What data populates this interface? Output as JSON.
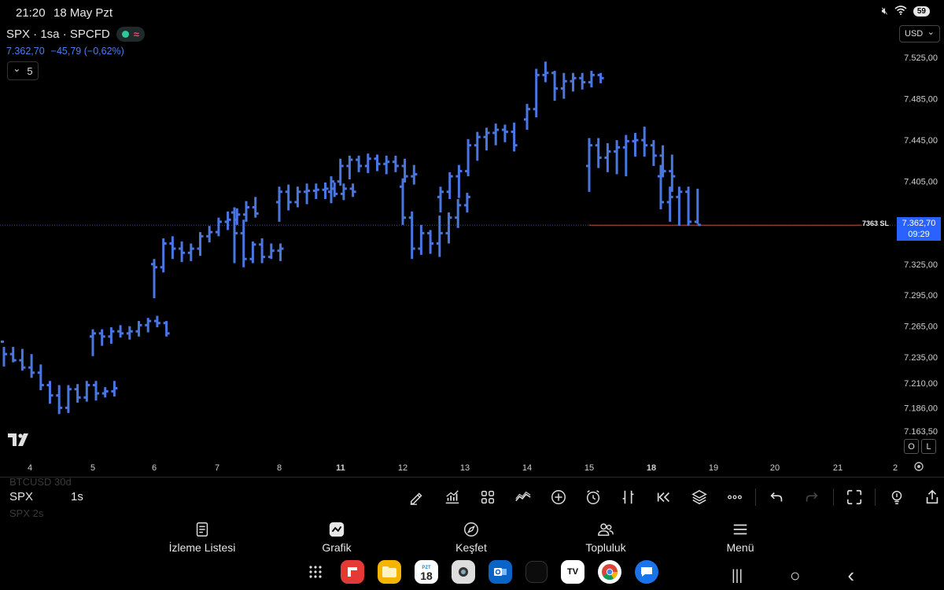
{
  "status_bar": {
    "time": "21:20",
    "date": "18 May Pzt",
    "battery": "59"
  },
  "header": {
    "symbol": "SPX · 1sa · SPCFD",
    "wave_glyph": "≈",
    "last_price": "7.362,70",
    "change": "−45,79 (−0,62%)",
    "interval_value": "5",
    "interval_chevron": "⌄",
    "currency": "USD",
    "currency_chevron": "⌄"
  },
  "chart_data": {
    "type": "ohlc",
    "bar_interval": "1sa",
    "x_labels": [
      "4",
      "5",
      "6",
      "7",
      "8",
      "11",
      "12",
      "13",
      "14",
      "15",
      "18",
      "19",
      "20",
      "21",
      "2"
    ],
    "y_labels": [
      "7.525,00",
      "7.485,00",
      "7.445,00",
      "7.405,00",
      "7.362,70",
      "7.325,00",
      "7.295,00",
      "7.265,00",
      "7.235,00",
      "7.210,00",
      "7.186,00",
      "7.163,50"
    ],
    "current_price": "7.362,70",
    "current_time_left": "09:29",
    "stop_level_label": "7363 SL",
    "series": [
      {
        "date": "4",
        "bars": [
          [
            7250,
            7245,
            7226,
            7238
          ],
          [
            7238,
            7245,
            7230,
            7232
          ],
          [
            7232,
            7243,
            7222,
            7225
          ],
          [
            7225,
            7238,
            7215,
            7220
          ],
          [
            7220,
            7228,
            7203,
            7208
          ],
          [
            7208,
            7212,
            7190,
            7198
          ],
          [
            7198,
            7208,
            7180,
            7186
          ],
          [
            7186,
            7208,
            7181,
            7204
          ],
          [
            7204,
            7209,
            7191,
            7196
          ],
          [
            7196,
            7212,
            7192,
            7208
          ],
          [
            7208,
            7212,
            7193,
            7200
          ],
          [
            7200,
            7206,
            7196,
            7202
          ],
          [
            7202,
            7212,
            7197,
            7205
          ]
        ]
      },
      {
        "date": "5",
        "bars": [
          [
            7255,
            7262,
            7236,
            7258
          ],
          [
            7258,
            7262,
            7246,
            7255
          ],
          [
            7255,
            7264,
            7248,
            7260
          ],
          [
            7260,
            7266,
            7254,
            7258
          ],
          [
            7258,
            7265,
            7252,
            7260
          ],
          [
            7260,
            7270,
            7255,
            7266
          ],
          [
            7266,
            7273,
            7259,
            7270
          ],
          [
            7270,
            7275,
            7264,
            7268
          ],
          [
            7268,
            7270,
            7255,
            7258
          ]
        ]
      },
      {
        "date": "6",
        "bars": [
          [
            7325,
            7330,
            7292,
            7322
          ],
          [
            7322,
            7350,
            7317,
            7345
          ],
          [
            7345,
            7352,
            7330,
            7340
          ],
          [
            7340,
            7347,
            7327,
            7336
          ],
          [
            7336,
            7345,
            7328,
            7340
          ],
          [
            7340,
            7356,
            7333,
            7352
          ],
          [
            7352,
            7362,
            7346,
            7356
          ],
          [
            7356,
            7370,
            7352,
            7366
          ],
          [
            7366,
            7376,
            7358,
            7368
          ],
          [
            7368,
            7379,
            7363,
            7373
          ],
          [
            7373,
            7386,
            7366,
            7380
          ],
          [
            7380,
            7390,
            7370,
            7374
          ]
        ]
      },
      {
        "date": "7",
        "bars": [
          [
            7375,
            7380,
            7326,
            7355
          ],
          [
            7355,
            7368,
            7322,
            7330
          ],
          [
            7330,
            7347,
            7326,
            7344
          ],
          [
            7344,
            7350,
            7326,
            7332
          ],
          [
            7332,
            7345,
            7330,
            7338
          ],
          [
            7338,
            7345,
            7328,
            7340
          ]
        ]
      },
      {
        "date": "8",
        "bars": [
          [
            7385,
            7400,
            7366,
            7395
          ],
          [
            7395,
            7402,
            7377,
            7385
          ],
          [
            7385,
            7400,
            7380,
            7395
          ],
          [
            7395,
            7403,
            7383,
            7396
          ],
          [
            7396,
            7403,
            7388,
            7397
          ],
          [
            7397,
            7404,
            7388,
            7398
          ],
          [
            7398,
            7404,
            7390,
            7393
          ],
          [
            7393,
            7403,
            7387,
            7398
          ],
          [
            7398,
            7403,
            7390,
            7395
          ]
        ]
      },
      {
        "date": "11",
        "bars": [
          [
            7395,
            7410,
            7384,
            7405
          ],
          [
            7405,
            7427,
            7401,
            7420
          ],
          [
            7420,
            7430,
            7407,
            7426
          ],
          [
            7426,
            7430,
            7414,
            7420
          ],
          [
            7420,
            7432,
            7413,
            7427
          ],
          [
            7427,
            7431,
            7415,
            7422
          ],
          [
            7422,
            7430,
            7412,
            7424
          ],
          [
            7424,
            7430,
            7414,
            7420
          ],
          [
            7420,
            7427,
            7404,
            7410
          ],
          [
            7410,
            7421,
            7402,
            7412
          ]
        ]
      },
      {
        "date": "12",
        "bars": [
          [
            7400,
            7408,
            7363,
            7370
          ],
          [
            7370,
            7376,
            7330,
            7340
          ],
          [
            7340,
            7363,
            7334,
            7355
          ],
          [
            7355,
            7358,
            7335,
            7345
          ],
          [
            7345,
            7372,
            7332,
            7355
          ],
          [
            7355,
            7375,
            7345,
            7370
          ],
          [
            7370,
            7388,
            7360,
            7382
          ],
          [
            7382,
            7394,
            7375,
            7390
          ]
        ]
      },
      {
        "date": "13",
        "bars": [
          [
            7390,
            7400,
            7375,
            7395
          ],
          [
            7395,
            7414,
            7388,
            7410
          ],
          [
            7410,
            7421,
            7389,
            7415
          ],
          [
            7415,
            7446,
            7410,
            7440
          ],
          [
            7440,
            7453,
            7425,
            7448
          ],
          [
            7448,
            7457,
            7435,
            7452
          ],
          [
            7452,
            7461,
            7440,
            7455
          ],
          [
            7455,
            7460,
            7443,
            7453
          ],
          [
            7453,
            7462,
            7434,
            7440
          ]
        ]
      },
      {
        "date": "14",
        "bars": [
          [
            7465,
            7480,
            7455,
            7475
          ],
          [
            7475,
            7514,
            7467,
            7508
          ],
          [
            7508,
            7521,
            7501,
            7510
          ],
          [
            7510,
            7512,
            7483,
            7495
          ],
          [
            7495,
            7510,
            7485,
            7502
          ],
          [
            7502,
            7510,
            7492,
            7505
          ],
          [
            7505,
            7510,
            7494,
            7501
          ],
          [
            7501,
            7512,
            7496,
            7508
          ],
          [
            7508,
            7510,
            7500,
            7505
          ]
        ]
      },
      {
        "date": "15",
        "bars": [
          [
            7420,
            7447,
            7395,
            7440
          ],
          [
            7440,
            7447,
            7418,
            7428
          ],
          [
            7428,
            7442,
            7414,
            7434
          ],
          [
            7434,
            7445,
            7412,
            7438
          ],
          [
            7438,
            7450,
            7410,
            7444
          ],
          [
            7444,
            7452,
            7429,
            7445
          ],
          [
            7445,
            7458,
            7429,
            7440
          ],
          [
            7440,
            7445,
            7420,
            7430
          ],
          [
            7430,
            7440,
            7409,
            7415
          ],
          [
            7415,
            7431,
            7395,
            7410
          ]
        ]
      },
      {
        "date": "18",
        "bars": [
          [
            7410,
            7421,
            7378,
            7385
          ],
          [
            7385,
            7400,
            7366,
            7390
          ],
          [
            7390,
            7400,
            7362,
            7395
          ],
          [
            7395,
            7400,
            7362,
            7366
          ],
          [
            7366,
            7398,
            7364,
            7363
          ]
        ]
      }
    ]
  },
  "chart": {
    "colors": {
      "bar": "#4a76e0",
      "price_line": "#c0503a",
      "price_tag": "#2962ff",
      "dotted_line": "#3a4a8a"
    }
  },
  "ol_buttons": [
    "O",
    "L"
  ],
  "symbol_panel": {
    "ghost_top": "BTCUSD  30d",
    "symbol": "SPX",
    "interval": "1s",
    "ghost_bottom": "SPX  2s"
  },
  "toolbar_icons": [
    "pencil-icon",
    "indicators-icon",
    "layout-icon",
    "compare-icon",
    "add-icon",
    "alert-icon",
    "replay-icon",
    "rewind-icon",
    "layers-icon",
    "more-icon",
    "undo-icon",
    "redo-icon",
    "fullscreen-icon",
    "idea-icon",
    "share-icon"
  ],
  "bottom_nav": [
    {
      "label": "İzleme Listesi",
      "icon": "watchlist-icon"
    },
    {
      "label": "Grafik",
      "icon": "chart-icon"
    },
    {
      "label": "Keşfet",
      "icon": "compass-icon"
    },
    {
      "label": "Topluluk",
      "icon": "community-icon"
    },
    {
      "label": "Menü",
      "icon": "menu-icon"
    }
  ],
  "dock": {
    "calendar_month": "PZT",
    "calendar_day": "18",
    "tradingview_glyph": "TV",
    "sys_recents": "|||",
    "sys_home": "○",
    "sys_back": "‹"
  }
}
